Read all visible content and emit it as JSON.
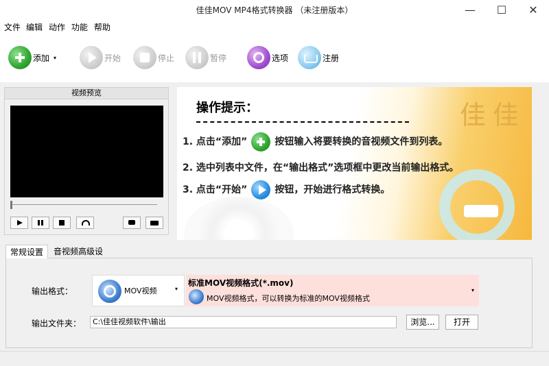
{
  "window": {
    "title": "佳佳MOV MP4格式转换器 （未注册版本）",
    "minimize": "—",
    "maximize": "☐",
    "close": "✕"
  },
  "menu": [
    "文件",
    "编辑",
    "动作",
    "功能",
    "帮助"
  ],
  "toolbar": {
    "add": "添加",
    "add_arrow": "▾",
    "start": "开始",
    "stop": "停止",
    "pause": "暂停",
    "options": "选项",
    "register": "注册"
  },
  "preview": {
    "title": "视频预览"
  },
  "tips": {
    "title": "操作提示：",
    "brand": "佳佳",
    "line1_pre": "1. 点击“添加”",
    "line1_post": "按钮输入将要转换的音视频文件到列表。",
    "line2": "2. 选中列表中文件，在“输出格式”选项框中更改当前输出格式。",
    "line3_pre": "3. 点击“开始”",
    "line3_post": "按钮，开始进行格式转换。"
  },
  "tabs": [
    "常规设置",
    "音视频高级设置"
  ],
  "settings": {
    "output_format_label": "输出格式：",
    "format_name": "MOV视频",
    "format_title": "标准MOV视频格式(*.mov)",
    "format_desc": "MOV视频格式，可以转换为标准的MOV视频格式",
    "output_folder_label": "输出文件夹：",
    "output_folder": "C:\\佳佳视频软件\\输出",
    "browse": "浏览...",
    "open": "打开",
    "dropdown_arrow": "▾"
  },
  "colors": {
    "accent_add": "#2fa52f",
    "format_desc_bg": "#fde0dc",
    "tips_gold": "#f6b83e"
  }
}
